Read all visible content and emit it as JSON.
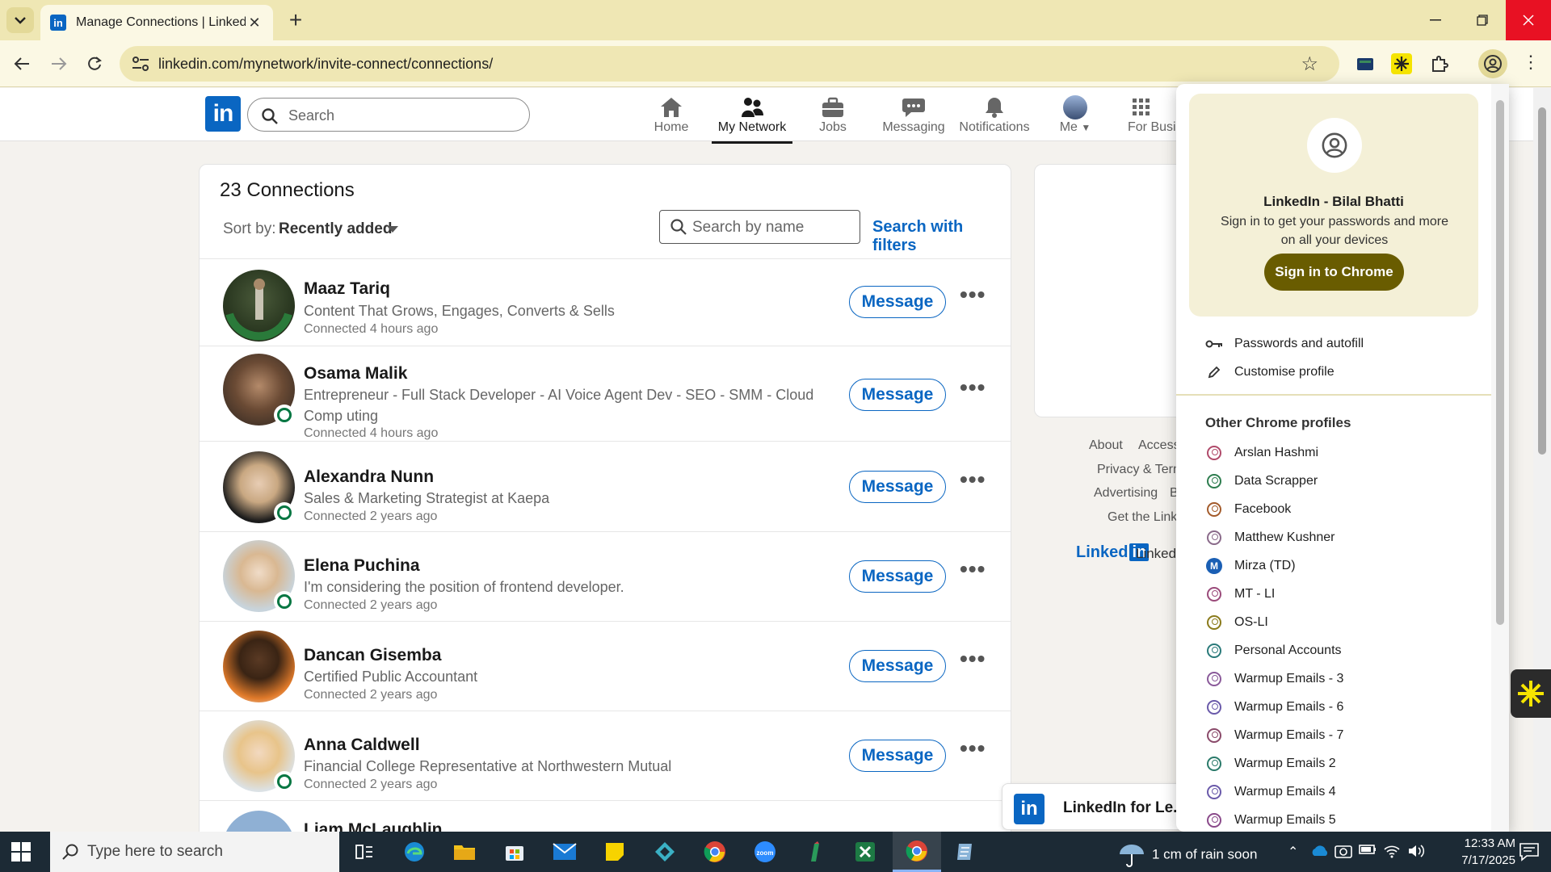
{
  "browser": {
    "tab_title": "Manage Connections | LinkedIn",
    "url": "linkedin.com/mynetwork/invite-connect/connections/"
  },
  "linkedin": {
    "search_placeholder": "Search",
    "nav": [
      {
        "label": "Home",
        "icon": "home-icon"
      },
      {
        "label": "My Network",
        "icon": "people-icon"
      },
      {
        "label": "Jobs",
        "icon": "briefcase-icon"
      },
      {
        "label": "Messaging",
        "icon": "chat-icon"
      },
      {
        "label": "Notifications",
        "icon": "bell-icon"
      },
      {
        "label": "Me",
        "icon": "avatar"
      },
      {
        "label": "For Busin",
        "icon": "grid-icon"
      }
    ]
  },
  "connections": {
    "title": "23 Connections",
    "sort_label": "Sort by:",
    "sort_value": "Recently added",
    "name_search_placeholder": "Search by name",
    "filters_link": "Search with filters",
    "message_label": "Message",
    "people": [
      {
        "name": "Maaz Tariq",
        "headline": "Content That Grows, Engages, Converts & Sells",
        "connected": "Connected 4 hours ago",
        "open_to_work": true,
        "open_badge": false
      },
      {
        "name": "Osama Malik",
        "headline": "Entrepreneur - Full Stack Developer - AI Voice Agent Dev - SEO - SMM - Cloud Comp uting",
        "connected": "Connected 4 hours ago",
        "open_badge": true
      },
      {
        "name": "Alexandra Nunn",
        "headline": "Sales & Marketing Strategist at Kaepa",
        "connected": "Connected 2 years ago",
        "open_badge": true
      },
      {
        "name": "Elena Puchina",
        "headline": "I'm considering the position of frontend developer.",
        "connected": "Connected 2 years ago",
        "open_badge": true
      },
      {
        "name": "Dancan Gisemba",
        "headline": "Certified Public Accountant",
        "connected": "Connected 2 years ago",
        "open_badge": false
      },
      {
        "name": "Anna Caldwell",
        "headline": "Financial College Representative at Northwestern Mutual",
        "connected": "Connected 2 years ago",
        "open_badge": true
      },
      {
        "name": "Liam McLaughlin",
        "headline": "",
        "connected": "",
        "open_badge": false
      }
    ]
  },
  "footer": {
    "links": [
      "About",
      "Accessi",
      "Privacy & Term",
      "Advertising",
      "B",
      "Get the Linke"
    ],
    "brand_text": "Linked",
    "brand_box": "in",
    "brand_suffix": "Linkedl",
    "learning_toast": "LinkedIn for Le..."
  },
  "profile_menu": {
    "name": "LinkedIn - Bilal Bhatti",
    "subtitle": "Sign in to get your passwords and more on all your devices",
    "signin_button": "Sign in to Chrome",
    "actions": [
      {
        "label": "Passwords and autofill",
        "icon": "key-icon"
      },
      {
        "label": "Customise profile",
        "icon": "pencil-icon"
      }
    ],
    "other_heading": "Other Chrome profiles",
    "profiles": [
      {
        "label": "Arslan Hashmi",
        "color": "#b04a6a"
      },
      {
        "label": "Data Scrapper",
        "color": "#2e7d4f"
      },
      {
        "label": "Facebook",
        "color": "#a35a2a"
      },
      {
        "label": "Matthew Kushner",
        "color": "#8a6a8a"
      },
      {
        "label": "Mirza (TD)",
        "color": "#1a5fb4",
        "letter": "M"
      },
      {
        "label": "MT - LI",
        "color": "#9a4a7a"
      },
      {
        "label": "OS-LI",
        "color": "#8a7a1a"
      },
      {
        "label": "Personal Accounts",
        "color": "#2a7a7a"
      },
      {
        "label": "Warmup Emails - 3",
        "color": "#8a5a9a"
      },
      {
        "label": "Warmup Emails - 6",
        "color": "#6a5aaa"
      },
      {
        "label": "Warmup Emails - 7",
        "color": "#8a4a6a"
      },
      {
        "label": "Warmup Emails 2",
        "color": "#2a7a6a"
      },
      {
        "label": "Warmup Emails 4",
        "color": "#6a5aaa"
      },
      {
        "label": "Warmup Emails 5",
        "color": "#8a4a8a"
      }
    ]
  },
  "taskbar": {
    "search_placeholder": "Type here to search",
    "weather": "1 cm of rain soon",
    "time": "12:33 AM",
    "date": "7/17/2025"
  }
}
